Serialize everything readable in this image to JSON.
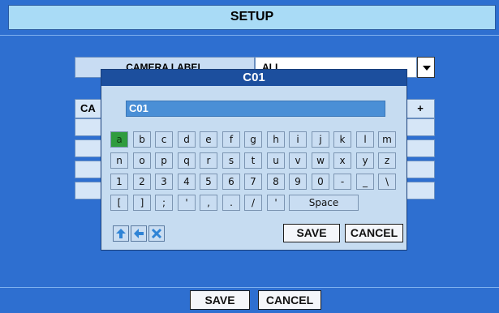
{
  "header": {
    "title": "SETUP"
  },
  "background_panel": {
    "camera_label_label": "CAMERA LABEL",
    "camera_label_value": "ALL",
    "table_header_left": "CA",
    "table_header_right": "+"
  },
  "dialog": {
    "title": "C01",
    "input_value": "C01",
    "keyboard_rows": [
      [
        "a",
        "b",
        "c",
        "d",
        "e",
        "f",
        "g",
        "h",
        "i",
        "j",
        "k",
        "l",
        "m"
      ],
      [
        "n",
        "o",
        "p",
        "q",
        "r",
        "s",
        "t",
        "u",
        "v",
        "w",
        "x",
        "y",
        "z"
      ],
      [
        "1",
        "2",
        "3",
        "4",
        "5",
        "6",
        "7",
        "8",
        "9",
        "0",
        "-",
        "_",
        "\\"
      ],
      [
        "[",
        "]",
        ";",
        "'",
        ",",
        ".",
        "/",
        "'",
        "Space"
      ]
    ],
    "selected_key": "a",
    "tools": [
      "up-arrow-icon",
      "left-arrow-icon",
      "close-icon"
    ],
    "save_label": "SAVE",
    "cancel_label": "CANCEL"
  },
  "footer": {
    "save_label": "SAVE",
    "cancel_label": "CANCEL"
  },
  "colors": {
    "background": "#2e6fd0",
    "title_bar": "#a9dbf6",
    "dialog_title": "#1c4f9e",
    "selected_key": "#2f9c3e"
  }
}
